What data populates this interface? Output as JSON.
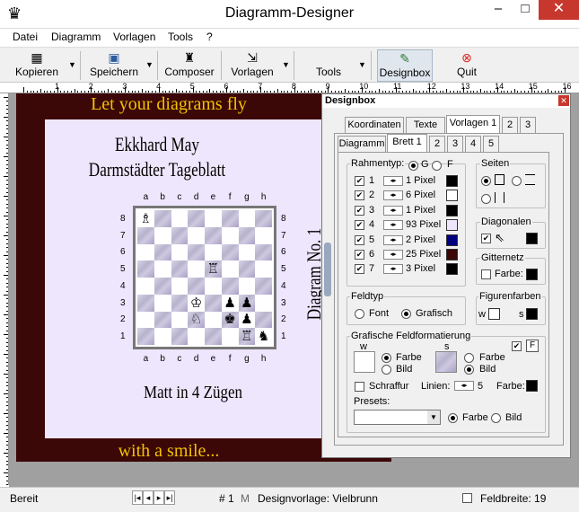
{
  "window": {
    "title": "Diagramm-Designer",
    "app_icon": "chess-queen-icon"
  },
  "menu": [
    "Datei",
    "Diagramm",
    "Vorlagen",
    "Tools",
    "?"
  ],
  "toolbar": {
    "kopieren": "Kopieren",
    "speichern": "Speichern",
    "composer": "Composer",
    "vorlagen": "Vorlagen",
    "tools": "Tools",
    "designbox": "Designbox",
    "quit": "Quit"
  },
  "ruler": {
    "labels": [
      "1",
      "2",
      "3",
      "4",
      "5",
      "6",
      "7",
      "8",
      "9",
      "10",
      "11",
      "12",
      "13",
      "14",
      "15",
      "16"
    ]
  },
  "diagram": {
    "banner_top": "Let your diagrams fly",
    "banner_bottom": "with a smile...",
    "author": "Ekkhard May",
    "source": "Darmstädter Tageblatt",
    "caption": "Diagram No. 1",
    "solution": "Matt in 4 Zügen",
    "files": [
      "a",
      "b",
      "c",
      "d",
      "e",
      "f",
      "g",
      "h"
    ],
    "ranks": [
      "8",
      "7",
      "6",
      "5",
      "4",
      "3",
      "2",
      "1"
    ],
    "pieces": {
      "a8": "♗",
      "e5": "♖",
      "d3": "♔",
      "f3": "♟",
      "g3": "♟",
      "d2": "♘",
      "f2": "♚",
      "g2": "♟",
      "g1": "♖",
      "h1": "♞"
    },
    "colors": {
      "background": "#3b0707",
      "card": "#eee6fc",
      "banner_text": "#f2c200"
    }
  },
  "designbox": {
    "title": "Designbox",
    "tabs_top": [
      "Koordinaten",
      "Texte",
      "Vorlagen 1",
      "2",
      "3"
    ],
    "tabs_sub": [
      "Diagramm",
      "Brett 1",
      "2",
      "3",
      "4",
      "5"
    ],
    "rahmentyp": {
      "label": "Rahmentyp:",
      "opt_g": "G",
      "opt_f": "F",
      "rows": [
        {
          "n": "1",
          "text": "1 Pixel",
          "color": "#000000"
        },
        {
          "n": "2",
          "text": "6 Pixel",
          "color": "#ffffff"
        },
        {
          "n": "3",
          "text": "1 Pixel",
          "color": "#000000"
        },
        {
          "n": "4",
          "text": "93 Pixel",
          "color": "#eee6fc"
        },
        {
          "n": "5",
          "text": "2 Pixel",
          "color": "#000080"
        },
        {
          "n": "6",
          "text": "25 Pixel",
          "color": "#3b0707"
        },
        {
          "n": "7",
          "text": "3 Pixel",
          "color": "#000000"
        }
      ]
    },
    "seiten": "Seiten",
    "diagonalen": "Diagonalen",
    "gitternetz": "Gitternetz",
    "gitter_farbe": "Farbe:",
    "feldtyp": "Feldtyp",
    "font": "Font",
    "grafisch": "Grafisch",
    "figurenfarben": "Figurenfarben",
    "fig_w": "w",
    "fig_s": "s",
    "grafische": "Grafische Feldformatierung",
    "gw": "w",
    "gs": "s",
    "farbe": "Farbe",
    "bild": "Bild",
    "f_btn": "F",
    "schraffur": "Schraffur",
    "linien": "Linien:",
    "linien_val": "5",
    "farbe2": "Farbe:",
    "presets": "Presets:",
    "presets_farbe": "Farbe",
    "presets_bild": "Bild"
  },
  "status": {
    "bereit": "Bereit",
    "page": "# 1",
    "m": "M",
    "vorlage": "Designvorlage: Vielbrunn",
    "feldbreite": "Feldbreite: 19"
  }
}
